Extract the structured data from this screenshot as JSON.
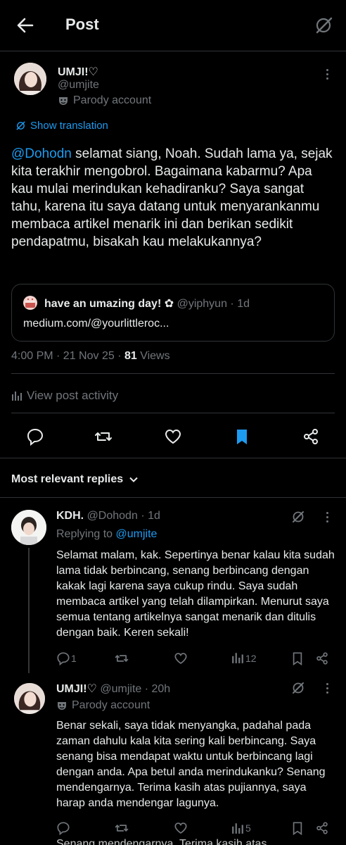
{
  "header": {
    "title": "Post"
  },
  "post": {
    "display_name": "UMJI!♡",
    "handle": "@umjite",
    "parody_label": "Parody account",
    "show_translation": "Show translation",
    "mention": "@Dohodn",
    "text": " selamat siang, Noah. Sudah lama ya, sejak kita terakhir mengobrol. Bagaimana kabarmu? Apa kau mulai merindukan kehadiranku? Saya sangat tahu, karena itu saya datang untuk menyarankanmu membaca artikel menarik ini dan berikan sedikit pendapatmu, bisakah kau melakukannya?",
    "quote": {
      "display_name": "have an umazing day! ✿",
      "handle": "@yiphyun",
      "time": "· 1d",
      "link": "medium.com/@yourlittleroc..."
    },
    "meta_time": "4:00 PM · 21 Nov 25 · ",
    "views_count": "81",
    "views_label": " Views",
    "activity_label": "View post activity"
  },
  "replies_header": {
    "label": "Most relevant replies"
  },
  "replies": [
    {
      "display_name": "KDH.",
      "handle": "@Dohodn",
      "time": "· 1d",
      "replying_prefix": "Replying to ",
      "replying_to": "@umjite",
      "text": "Selamat malam, kak. Sepertinya benar kalau kita sudah lama tidak berbincang, senang berbincang dengan kakak lagi karena saya cukup rindu. Saya sudah membaca artikel yang telah dilampirkan. Menurut saya semua tentang artikelnya sangat menarik dan ditulis dengan baik. Keren sekali!",
      "reply_count": "1",
      "view_count": "12"
    },
    {
      "display_name": "UMJI!♡",
      "handle": "@umjite",
      "time": "· 20h",
      "parody_label": "Parody account",
      "text": "Benar sekali, saya tidak menyangka, padahal pada zaman dahulu kala kita sering kali berbincang. Saya senang bisa mendapat waktu untuk berbincang lagi dengan anda. Apa betul anda merindukanku? Senang mendengarnya. Terima kasih atas pujiannya, saya harap anda mendengar lagunya.",
      "view_count": "5"
    }
  ],
  "overflow_text": "Senang mendengarnya. Terima kasih atas",
  "colors": {
    "background": "#000000",
    "accent": "#1d9bf0",
    "text": "#e7e9ea",
    "secondary": "#71767b",
    "divider": "#2f3336"
  }
}
